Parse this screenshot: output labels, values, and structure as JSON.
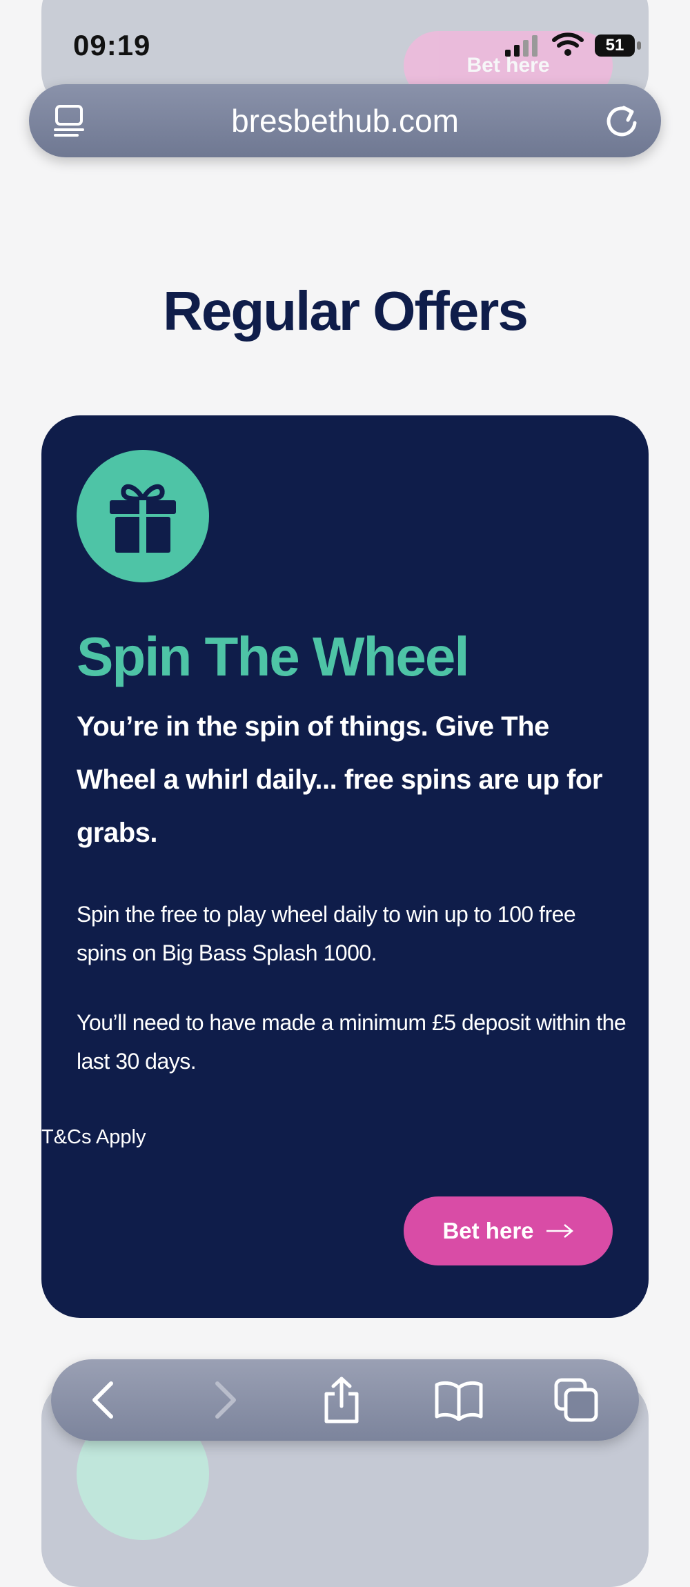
{
  "status_bar": {
    "time": "09:19",
    "battery": "51",
    "ghost_bet_label": "Bet here"
  },
  "browser": {
    "url": "bresbethub.com",
    "icons": {
      "tabs": "tabs-overview-icon",
      "reload": "reload-icon"
    }
  },
  "page": {
    "heading": "Regular Offers"
  },
  "offer": {
    "icon": "gift-icon",
    "title": "Spin The Wheel",
    "subtitle": "You’re in the spin of things. Give The Wheel a whirl daily... free spins are up for grabs.",
    "description": "Spin the free to play wheel daily to win up to 100 free spins on Big Bass Splash 1000.",
    "requirement": "You’ll need to have made a minimum £5 deposit within the last 30 days.",
    "terms": "T&Cs Apply",
    "button_label": "Bet here"
  },
  "toolbar": {
    "items": [
      "back-icon",
      "forward-icon",
      "share-icon",
      "bookmarks-icon",
      "tabs-icon"
    ]
  },
  "colors": {
    "card_bg": "#0f1d4a",
    "accent_green": "#4ec4a6",
    "accent_pink": "#d94ca6",
    "page_bg": "#f5f5f6"
  }
}
